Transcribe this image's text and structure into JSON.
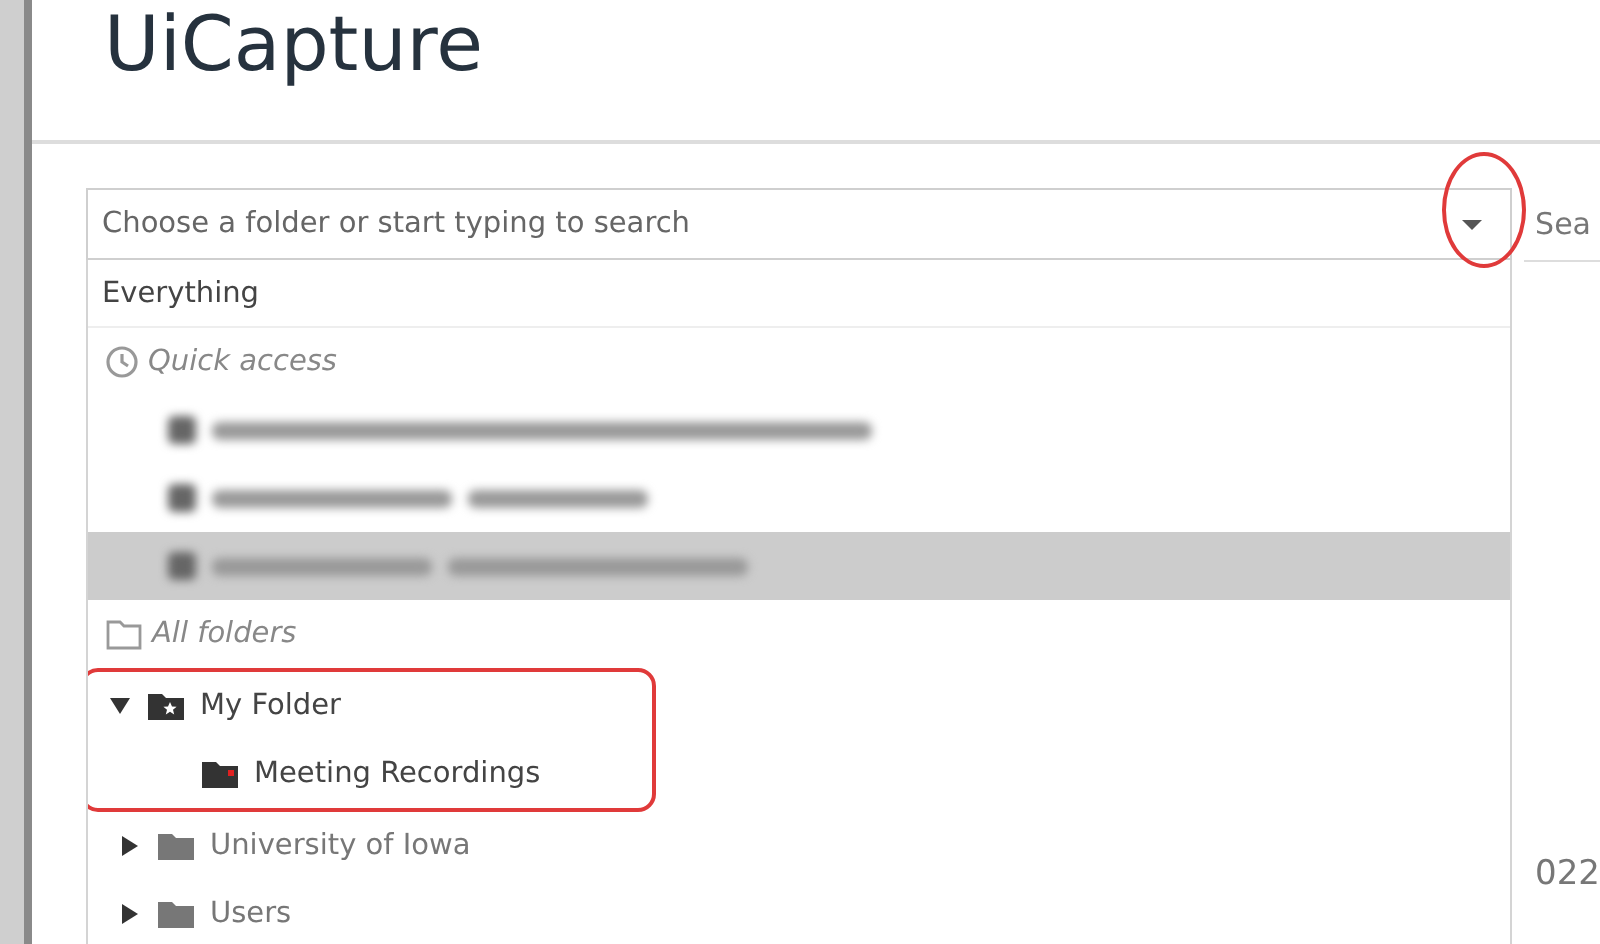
{
  "app": {
    "title": "UiCapture"
  },
  "folder_picker": {
    "placeholder": "Choose a folder or start typing to search",
    "caret_circled": true,
    "everything": "Everything",
    "quick_access": {
      "label": "Quick access",
      "items": [
        {
          "selected": false
        },
        {
          "selected": false
        },
        {
          "selected": true
        }
      ]
    },
    "all_folders": {
      "label": "All folders",
      "tree": [
        {
          "label": "My Folder",
          "kind": "starred",
          "expanded": true,
          "outlined": true,
          "children": [
            {
              "label": "Meeting Recordings",
              "kind": "recording"
            }
          ]
        },
        {
          "label": "University of Iowa",
          "kind": "plain",
          "expanded": false,
          "outlined": false
        },
        {
          "label": "Users",
          "kind": "plain",
          "expanded": false,
          "outlined": false
        }
      ]
    }
  },
  "search_button": "Sea",
  "side_text": "022"
}
